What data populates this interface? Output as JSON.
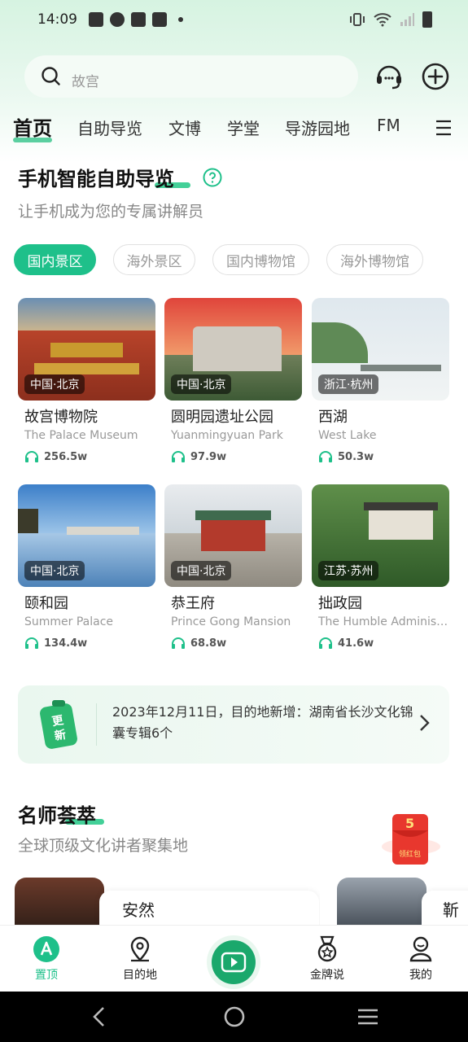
{
  "status_bar": {
    "time": "14:09"
  },
  "search": {
    "placeholder": "故宫"
  },
  "tabs": [
    "首页",
    "自助导览",
    "文博",
    "学堂",
    "导游园地",
    "FM"
  ],
  "guide_section": {
    "title": "手机智能自助导览",
    "subtitle": "让手机成为您的专属讲解员"
  },
  "filters": [
    "国内景区",
    "海外景区",
    "国内博物馆",
    "海外博物馆"
  ],
  "spots": [
    {
      "name": "故宫博物院",
      "en": "The Palace Museum",
      "region": "中国·北京",
      "plays": "256.5w"
    },
    {
      "name": "圆明园遗址公园",
      "en": "Yuanmingyuan Park",
      "region": "中国·北京",
      "plays": "97.9w"
    },
    {
      "name": "西湖",
      "en": "West Lake",
      "region": "浙江·杭州",
      "plays": "50.3w"
    },
    {
      "name": "颐和园",
      "en": "Summer Palace",
      "region": "中国·北京",
      "plays": "134.4w"
    },
    {
      "name": "恭王府",
      "en": "Prince Gong Mansion",
      "region": "中国·北京",
      "plays": "68.8w"
    },
    {
      "name": "拙政园",
      "en": "The Humble Administ...",
      "region": "江苏·苏州",
      "plays": "41.6w"
    }
  ],
  "notice": {
    "badge": "更新",
    "text": "2023年12月11日，目的地新增：湖南省长沙文化锦囊专辑6个"
  },
  "teachers_section": {
    "title": "名师荟萃",
    "subtitle": "全球顶级文化讲者聚集地",
    "red_packet_value": "5",
    "red_packet_label": "领红包"
  },
  "teachers": [
    {
      "name": "安然"
    },
    {
      "name": "靳玮"
    }
  ],
  "bottom_nav": [
    "置顶",
    "目的地",
    "金牌说",
    "我的"
  ],
  "colors": {
    "accent": "#1ec08a",
    "dark_green": "#1aa86c"
  }
}
